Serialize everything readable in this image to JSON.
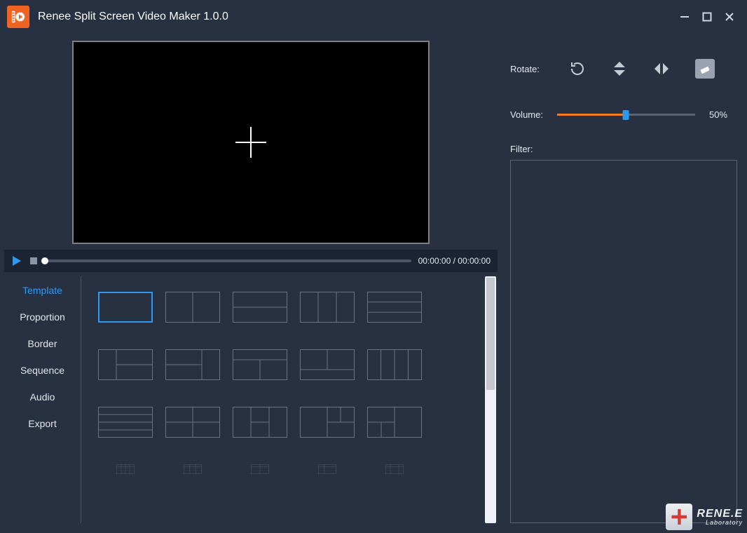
{
  "titlebar": {
    "title": "Renee Split Screen Video Maker 1.0.0"
  },
  "playback": {
    "time": "00:00:00 / 00:00:00"
  },
  "tabs": {
    "items": [
      {
        "label": "Template",
        "active": true
      },
      {
        "label": "Proportion",
        "active": false
      },
      {
        "label": "Border",
        "active": false
      },
      {
        "label": "Sequence",
        "active": false
      },
      {
        "label": "Audio",
        "active": false
      },
      {
        "label": "Export",
        "active": false
      }
    ]
  },
  "right": {
    "rotate_label": "Rotate:",
    "volume_label": "Volume:",
    "volume_value": "50%",
    "filter_label": "Filter:"
  },
  "brand": {
    "line1": "RENE.E",
    "line2": "Laboratory"
  }
}
